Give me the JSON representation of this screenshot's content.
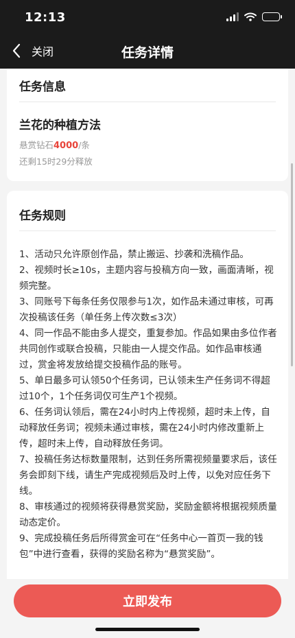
{
  "status_bar": {
    "time": "12:13"
  },
  "nav": {
    "back_label": "关闭",
    "title": "任务详情"
  },
  "info": {
    "section_title": "任务信息",
    "task_name": "兰花的种植方法",
    "reward_prefix": "悬赏钻石",
    "reward_amount": "4000",
    "reward_suffix": "/条",
    "remaining": "还剩15时29分释放"
  },
  "rules": {
    "section_title": "任务规则",
    "items": [
      "1、活动只允许原创作品，禁止搬运、抄袭和洗稿作品。",
      "2、视频时长≥10s，主题内容与投稿方向一致，画面清晰，视频完整。",
      "3、同账号下每条任务仅限参与1次，如作品未通过审核，可再次投稿该任务（单任务上传次数≤3次）",
      "4、同一作品不能由多人提交，重复参加。作品如果由多位作者共同创作或联合投稿，只能由一人提交作品。如作品审核通过，赏金将发放给提交投稿作品的账号。",
      "5、单日最多可认领50个任务词，已认领未生产任务词不得超过10个，1个任务词仅可生产1个视频。",
      "6、任务词认领后，需在24小时内上传视频，超时未上传，自动释放任务词；视频未通过审核，需在24小时内修改重新上传，超时未上传，自动释放任务词。",
      "7、投稿任务达标数量限制，达到任务所需视频量要求后，该任务会即刻下线，请生产完成视频后及时上传，以免对应任务下线。",
      "8、审核通过的视频将获得悬赏奖励，奖励金额将根据视频质量动态定价。",
      "9、完成投稿任务后所得赏金可在“任务中心一首页一我的钱包”中进行查看，获得的奖励名称为“悬赏奖励”。"
    ]
  },
  "footer": {
    "publish_label": "立即发布"
  },
  "colors": {
    "accent": "#ec5a55",
    "reward": "#e8443a",
    "header_bg": "#1b1b1b"
  }
}
